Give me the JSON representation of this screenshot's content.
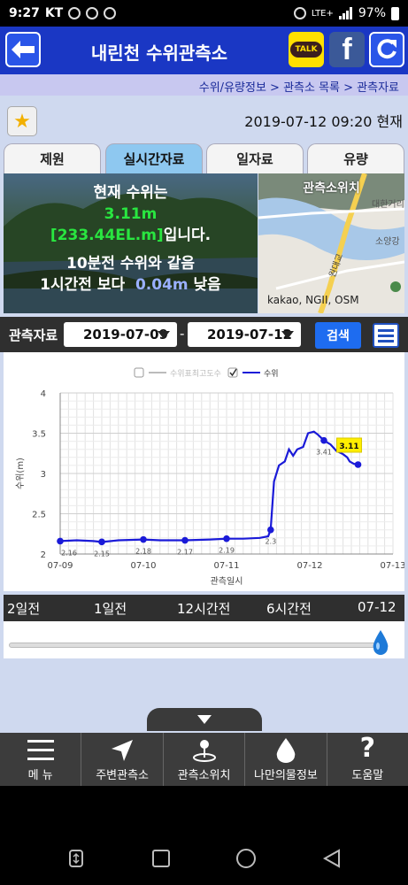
{
  "status_bar": {
    "time": "9:27",
    "carrier": "KT",
    "network": "LTE+",
    "battery": "97%"
  },
  "header": {
    "title": "내린천 수위관측소",
    "talk_label": "TALK",
    "fb_label": "f"
  },
  "breadcrumb": "수위/유량정보 > 관측소 목록 > 관측자료",
  "datetime": "2019-07-12  09:20 현재",
  "tabs": [
    {
      "label": "제원",
      "active": false
    },
    {
      "label": "실시간자료",
      "active": true
    },
    {
      "label": "일자료",
      "active": false
    },
    {
      "label": "유량",
      "active": false
    }
  ],
  "info": {
    "line1": "현재 수위는",
    "level_m": "3.11m",
    "level_el": "[233.44EL.m]",
    "line2_suffix": "입니다.",
    "line3": "10분전 수위와 같음",
    "line4_prefix": "1시간전 보다",
    "diff": "0.04m",
    "line4_suffix": "낮음"
  },
  "map": {
    "title": "관측소위치",
    "credit": "kakao, NGII, OSM",
    "labels": [
      "소양강",
      "원대교",
      "대한거리"
    ]
  },
  "filter": {
    "label": "관측자료",
    "start_date": "2019-07-09",
    "end_date": "2019-07-12",
    "dash": "-",
    "search": "검색"
  },
  "chart_data": {
    "type": "line",
    "legend": [
      {
        "name": "수위표최고도수",
        "checked": false,
        "color": "#bbbbbb"
      },
      {
        "name": "수위",
        "checked": true,
        "color": "#1a1ad8"
      }
    ],
    "ylabel": "수위(m)",
    "xlabel": "관측일시",
    "ylim": [
      2,
      4
    ],
    "yticks": [
      2,
      2.5,
      3,
      3.5,
      4
    ],
    "xticks": [
      "07-09",
      "07-10",
      "07-11",
      "07-12",
      "07-13"
    ],
    "xlim": [
      0,
      4
    ],
    "series": [
      {
        "name": "수위",
        "points": [
          [
            0.0,
            2.16
          ],
          [
            0.2,
            2.17
          ],
          [
            0.4,
            2.16
          ],
          [
            0.5,
            2.15
          ],
          [
            0.7,
            2.17
          ],
          [
            1.0,
            2.18
          ],
          [
            1.2,
            2.17
          ],
          [
            1.5,
            2.17
          ],
          [
            1.8,
            2.18
          ],
          [
            2.0,
            2.19
          ],
          [
            2.2,
            2.19
          ],
          [
            2.4,
            2.2
          ],
          [
            2.5,
            2.22
          ],
          [
            2.53,
            2.3
          ],
          [
            2.57,
            2.9
          ],
          [
            2.63,
            3.1
          ],
          [
            2.7,
            3.15
          ],
          [
            2.75,
            3.3
          ],
          [
            2.8,
            3.22
          ],
          [
            2.85,
            3.3
          ],
          [
            2.92,
            3.33
          ],
          [
            2.98,
            3.5
          ],
          [
            3.05,
            3.52
          ],
          [
            3.1,
            3.48
          ],
          [
            3.17,
            3.41
          ],
          [
            3.25,
            3.36
          ],
          [
            3.32,
            3.28
          ],
          [
            3.4,
            3.24
          ],
          [
            3.45,
            3.2
          ],
          [
            3.48,
            3.15
          ],
          [
            3.53,
            3.12
          ],
          [
            3.58,
            3.11
          ]
        ],
        "markers": [
          [
            0.0,
            2.16
          ],
          [
            0.5,
            2.15
          ],
          [
            1.0,
            2.18
          ],
          [
            1.5,
            2.17
          ],
          [
            2.0,
            2.19
          ],
          [
            2.53,
            2.3
          ],
          [
            3.17,
            3.41
          ],
          [
            3.58,
            3.11
          ]
        ],
        "marker_labels": [
          "2.16",
          "2.15",
          "2.18",
          "2.17",
          "2.19",
          "2.3",
          "3.41"
        ]
      }
    ],
    "tooltip": {
      "x": 3.58,
      "y": 3.11,
      "label": "3.11"
    }
  },
  "range": {
    "labels": [
      "2일전",
      "1일전",
      "12시간전",
      "6시간전",
      "07-12"
    ],
    "value_fraction": 1.0
  },
  "bottom_nav": [
    {
      "label": "메 뉴",
      "icon": "menu-icon"
    },
    {
      "label": "주변관측소",
      "icon": "navigation-arrow-icon"
    },
    {
      "label": "관측소위치",
      "icon": "location-pin-icon"
    },
    {
      "label": "나만의물정보",
      "icon": "water-drop-icon"
    },
    {
      "label": "도움말",
      "icon": "question-icon"
    }
  ]
}
